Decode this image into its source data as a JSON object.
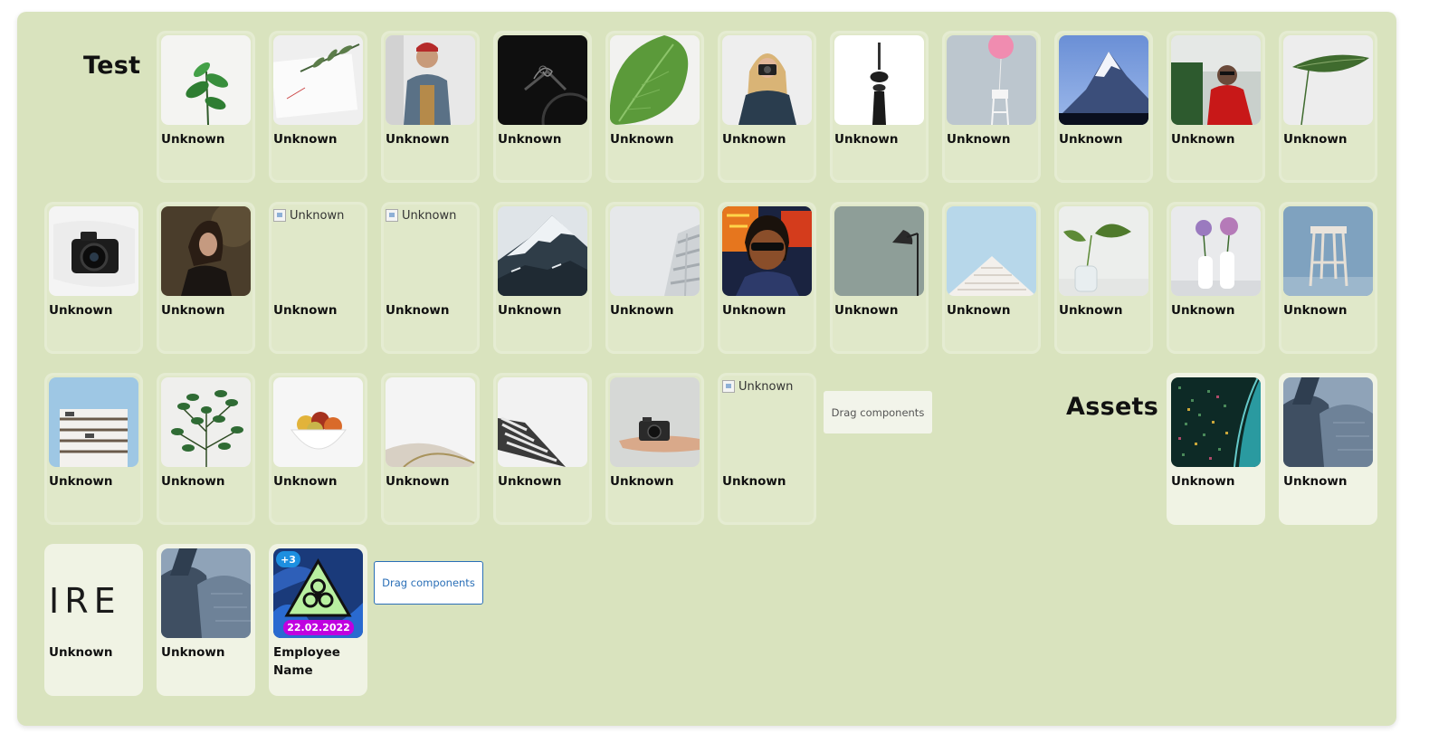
{
  "groups": {
    "test_title": "Test",
    "assets_title": "Assets"
  },
  "cards": {
    "unknown_label": "Unknown",
    "employee_label": "Employee Name",
    "broken_alt": "Unknown"
  },
  "drag": {
    "plain_label": "Drag components",
    "active_label": "Drag components"
  },
  "employee_card": {
    "count_badge": "+3",
    "date_badge": "22.02.2022",
    "date_badge_color": "#c000e0",
    "count_badge_color": "#1d8fe0"
  },
  "text_tile": {
    "text": "IRE"
  },
  "colors": {
    "board": "#d9e3be",
    "card": "#e0e8c9",
    "card_light": "#f0f3e4",
    "accent": "#2a6fb7"
  }
}
